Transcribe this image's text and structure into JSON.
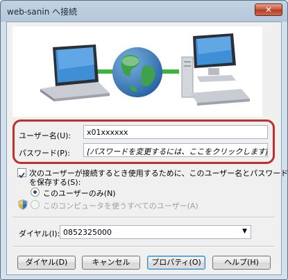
{
  "window": {
    "title": "web-sanin へ接続",
    "close_glyph": "✕"
  },
  "form": {
    "username_label": "ユーザー名(U):",
    "username_value": "x01xxxxxx",
    "password_label": "パスワード(P):",
    "password_value": "[パスワードを変更するには、ここをクリックします]",
    "save_checkbox_label_line1": "次のユーザーが接続するとき使用するために、このユーザー名とパスワード",
    "save_checkbox_label_line2": "を保存する(S):",
    "save_checked": true,
    "radio_me_only": "このユーザーのみ(N)",
    "radio_everyone": "このコンピュータを使うすべてのユーザー(A)",
    "dial_label": "ダイヤル(I):",
    "dial_value": "0852325000"
  },
  "buttons": {
    "dial": "ダイヤル(D)",
    "cancel": "キャンセル",
    "properties": "プロパティ(O)",
    "help": "ヘルプ(H)"
  },
  "colors": {
    "highlight": "#c0302a",
    "globe": "#2a7fc9",
    "link": "#3cb53c"
  },
  "icons": [
    "laptop-icon",
    "globe-icon",
    "desktop-computer-icon",
    "uac-shield-icon",
    "checkmark-icon",
    "dropdown-arrow-icon"
  ]
}
